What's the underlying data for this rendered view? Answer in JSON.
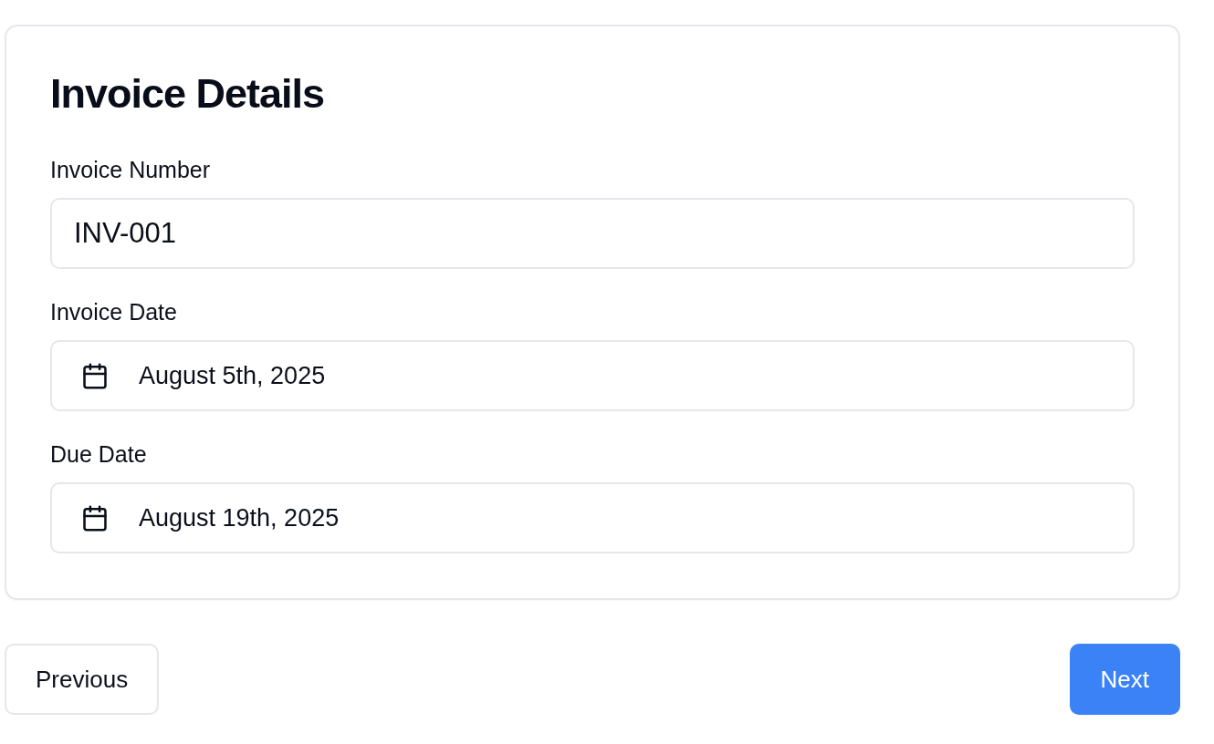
{
  "card": {
    "title": "Invoice Details",
    "fields": [
      {
        "label": "Invoice Number",
        "kind": "text",
        "value": "INV-001"
      },
      {
        "label": "Invoice Date",
        "kind": "date",
        "value": "August 5th, 2025"
      },
      {
        "label": "Due Date",
        "kind": "date",
        "value": "August 19th, 2025"
      }
    ]
  },
  "buttons": [
    {
      "label": "Previous",
      "kind": "secondary"
    },
    {
      "label": "Next",
      "kind": "primary"
    }
  ]
}
